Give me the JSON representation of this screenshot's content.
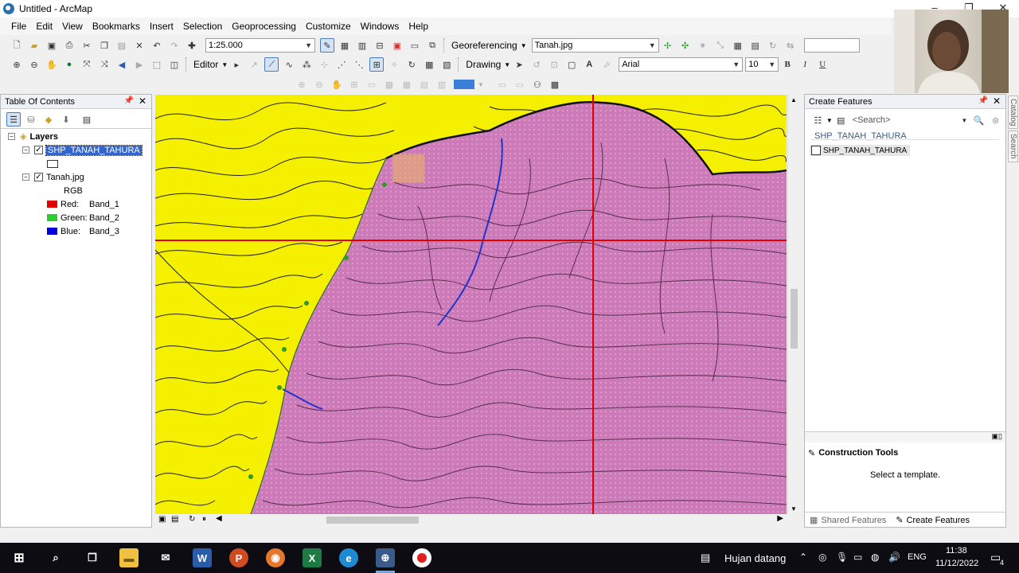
{
  "window": {
    "title": "Untitled - ArcMap"
  },
  "menu": [
    "File",
    "Edit",
    "View",
    "Bookmarks",
    "Insert",
    "Selection",
    "Geoprocessing",
    "Customize",
    "Windows",
    "Help"
  ],
  "toolbar": {
    "scale": "1:25.000",
    "georef_label": "Georeferencing",
    "georef_layer": "Tanah.jpg",
    "editor_label": "Editor",
    "drawing_label": "Drawing",
    "font_name": "Arial",
    "font_size": "10",
    "bold": "B",
    "italic": "I",
    "underline": "U"
  },
  "toc": {
    "title": "Table Of Contents",
    "root": "Layers",
    "layers": [
      {
        "name": "SHP_TANAH_TAHURA",
        "checked": true,
        "selected": true
      },
      {
        "name": "Tanah.jpg",
        "checked": true,
        "selected": false
      }
    ],
    "rgb_label": "RGB",
    "bands": [
      {
        "channel": "Red:",
        "band": "Band_1",
        "color": "#e00000"
      },
      {
        "channel": "Green:",
        "band": "Band_2",
        "color": "#2ecc2e"
      },
      {
        "channel": "Blue:",
        "band": "Band_3",
        "color": "#0000dd"
      }
    ]
  },
  "create_features": {
    "title": "Create Features",
    "search_placeholder": "<Search>",
    "group": "SHP_TANAH_TAHURA",
    "template": "SHP_TANAH_TAHURA",
    "construction_title": "Construction Tools",
    "construction_msg": "Select a template.",
    "tab_shared": "Shared Features",
    "tab_create": "Create Features"
  },
  "side_tabs": [
    "Catalog",
    "Search"
  ],
  "taskbar": {
    "weather": "Hujan datang",
    "lang": "ENG",
    "time": "11:38",
    "date": "11/12/2022",
    "notification_count": "4"
  },
  "colors": {
    "map_yellow": "#f4f000",
    "map_pink": "#cc7ab8",
    "crosshair": "#e00000",
    "selection": "#3366cc"
  }
}
